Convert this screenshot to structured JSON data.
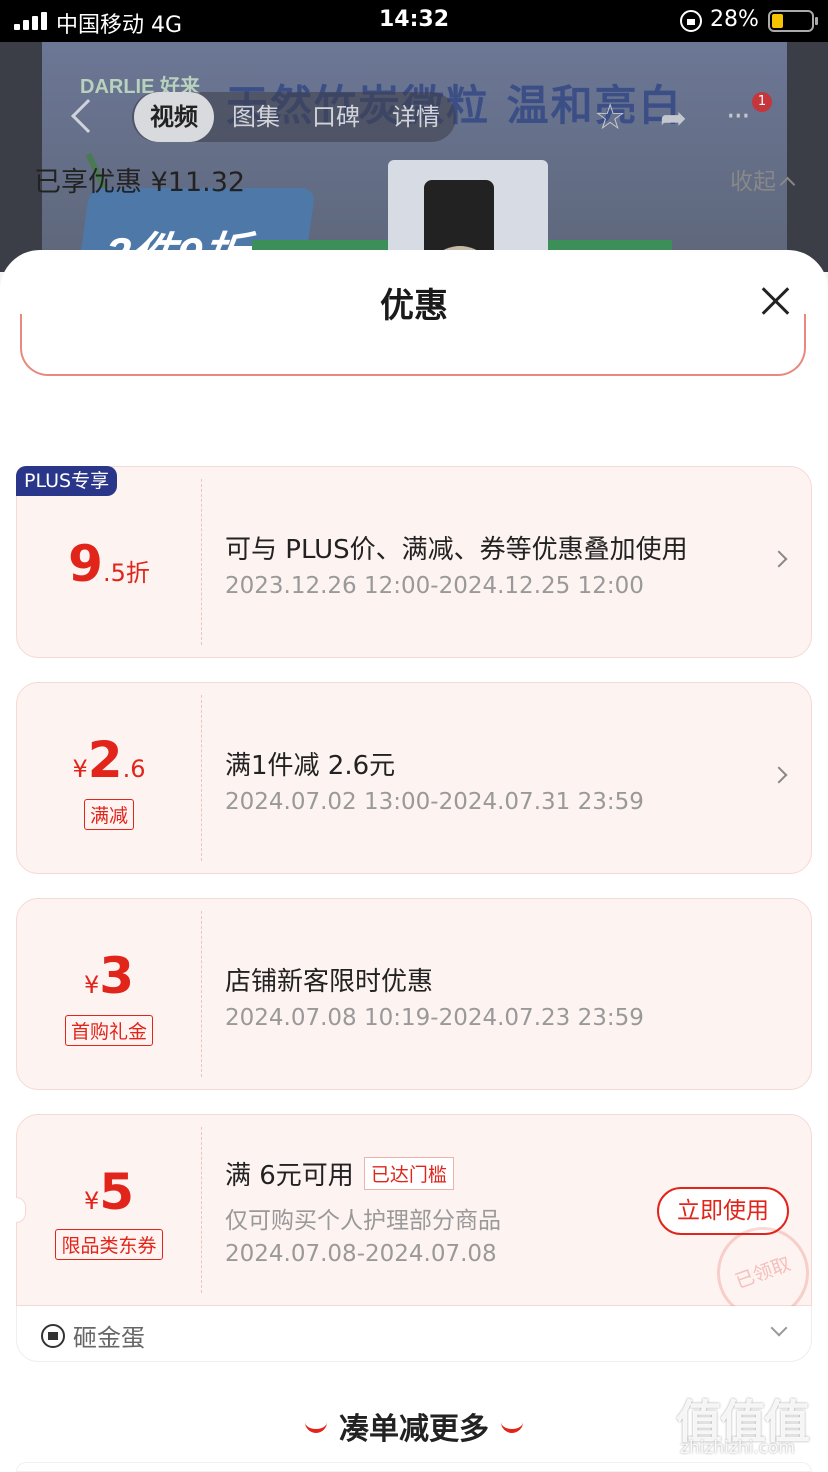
{
  "status_bar": {
    "carrier": "中国移动",
    "network": "4G",
    "time": "14:32",
    "battery": "28%",
    "battery_level": 0.28
  },
  "product": {
    "brand": "DARLIE 好来",
    "slogan": "天然竹炭微粒 温和亮白",
    "promo_badge": "2件9折"
  },
  "top_nav": {
    "tabs": [
      "视频",
      "图集",
      "口碑",
      "详情"
    ],
    "active_tab": "视频",
    "notification_count": "1",
    "icons": {
      "back": "back-arrow-icon",
      "favorite": "star-icon",
      "share": "share-icon",
      "more": "more-dots-icon"
    }
  },
  "sheet": {
    "title": "优惠",
    "close_icon": "close-icon",
    "summary": "已享优惠 ¥11.32",
    "collapse_label": "收起"
  },
  "cards": [
    {
      "badge": "PLUS专享",
      "amount_big": "9",
      "amount_small": ".5折",
      "title": "可与 PLUS价、满减、券等优惠叠加使用",
      "date": "2023.12.26 12:00-2024.12.25 12:00"
    },
    {
      "currency": "¥",
      "amount_big": "2",
      "amount_small": ".6",
      "tag": "满减",
      "title": "满1件减 2.6元",
      "date": "2024.07.02 13:00-2024.07.31 23:59"
    },
    {
      "currency": "¥",
      "amount_big": "3",
      "tag": "首购礼金",
      "title": "店铺新客限时优惠",
      "date": "2024.07.08 10:19-2024.07.23 23:59"
    },
    {
      "currency": "¥",
      "amount_big": "5",
      "tag": "限品类东券",
      "title": "满 6元可用",
      "threshold_badge": "已达门槛",
      "desc": "仅可购买个人护理部分商品",
      "date": "2024.07.08-2024.07.08",
      "button": "立即使用",
      "stamp": "已领取"
    }
  ],
  "egg_row": {
    "label": "砸金蛋"
  },
  "more_section": {
    "title": "凑单减更多"
  },
  "watermark": {
    "main": "值值值",
    "sub": "zhizhizhi.com"
  },
  "colors": {
    "accent": "#e1251b",
    "plus_badge": "#2a3689",
    "card_bg": "#fdf3f1"
  }
}
